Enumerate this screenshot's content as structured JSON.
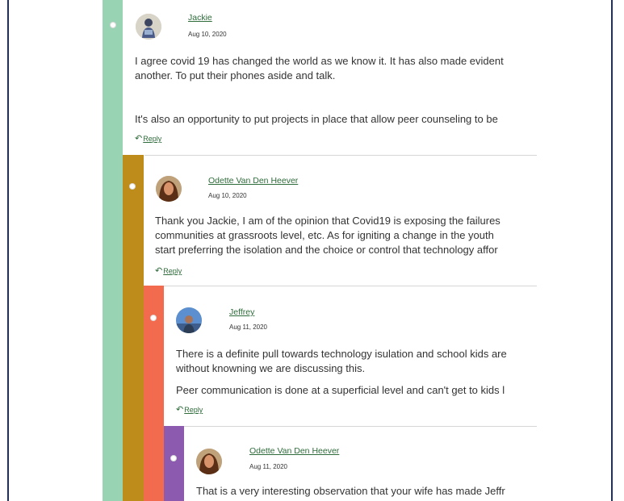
{
  "colors": {
    "level1": "#98d3b4",
    "level2": "#bd8c1a",
    "level3": "#f26b4f",
    "level4": "#8c5aae",
    "link": "#2e6b3a"
  },
  "comments": [
    {
      "author": "Jackie",
      "date": "Aug 10, 2020",
      "lines": [
        "I agree covid 19 has changed the world as we know it. It has also made evident",
        "another. To put their phones aside and talk.",
        "It's also an opportunity to put projects in place that allow peer counseling to be"
      ],
      "reply": "Reply",
      "avatar_icon": "avatar-image"
    },
    {
      "author": "Odette Van Den Heever",
      "date": "Aug 10, 2020",
      "lines": [
        "Thank you Jackie, I am of the opinion that Covid19 is exposing the failures",
        "communities at grassroots level, etc.   As for igniting a change in the youth",
        "start preferring the isolation and the choice or control that technology affor"
      ],
      "reply": "Reply",
      "avatar_icon": "avatar-image"
    },
    {
      "author": "Jeffrey",
      "date": "Aug 11, 2020",
      "lines": [
        "There is a definite pull towards technology isulation and school kids are",
        "without knowning we are discussing this.",
        "Peer communication is done at a superficial level and can't get to kids l"
      ],
      "reply": "Reply",
      "avatar_icon": "avatar-image"
    },
    {
      "author": "Odette Van Den Heever",
      "date": "Aug 11, 2020",
      "lines": [
        "That is a very interesting observation that your wife has made Jeffr"
      ],
      "avatar_icon": "avatar-image"
    }
  ]
}
